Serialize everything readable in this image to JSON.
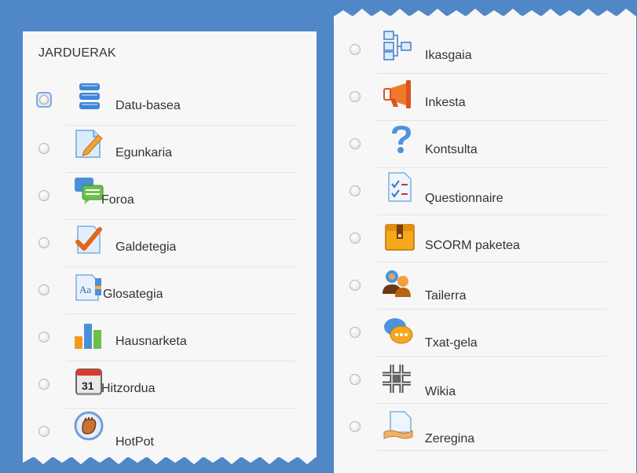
{
  "left": {
    "heading": "JARDUERAK",
    "items": [
      {
        "label": "Datu-basea",
        "icon": "database-icon"
      },
      {
        "label": "Egunkaria",
        "icon": "journal-icon"
      },
      {
        "label": "Foroa",
        "icon": "forum-icon"
      },
      {
        "label": "Galdetegia",
        "icon": "quiz-icon"
      },
      {
        "label": "Glosategia",
        "icon": "glossary-icon"
      },
      {
        "label": "Hausnarketa",
        "icon": "reflection-chart-icon"
      },
      {
        "label": "Hitzordua",
        "icon": "calendar-icon"
      },
      {
        "label": "HotPot",
        "icon": "hotpot-icon"
      }
    ]
  },
  "right": {
    "items": [
      {
        "label": "Ikasgaia",
        "icon": "lesson-icon"
      },
      {
        "label": "Inkesta",
        "icon": "megaphone-icon"
      },
      {
        "label": "Kontsulta",
        "icon": "question-icon"
      },
      {
        "label": "Questionnaire",
        "icon": "questionnaire-icon"
      },
      {
        "label": "SCORM paketea",
        "icon": "scorm-package-icon"
      },
      {
        "label": "Tailerra",
        "icon": "workshop-icon"
      },
      {
        "label": "Txat-gela",
        "icon": "chat-icon"
      },
      {
        "label": "Wikia",
        "icon": "wiki-icon"
      },
      {
        "label": "Zeregina",
        "icon": "assignment-icon"
      }
    ]
  },
  "colors": {
    "background": "#4f87c7",
    "panel": "#f7f7f7",
    "text": "#333333",
    "focus_ring": "#7fa9e0"
  }
}
